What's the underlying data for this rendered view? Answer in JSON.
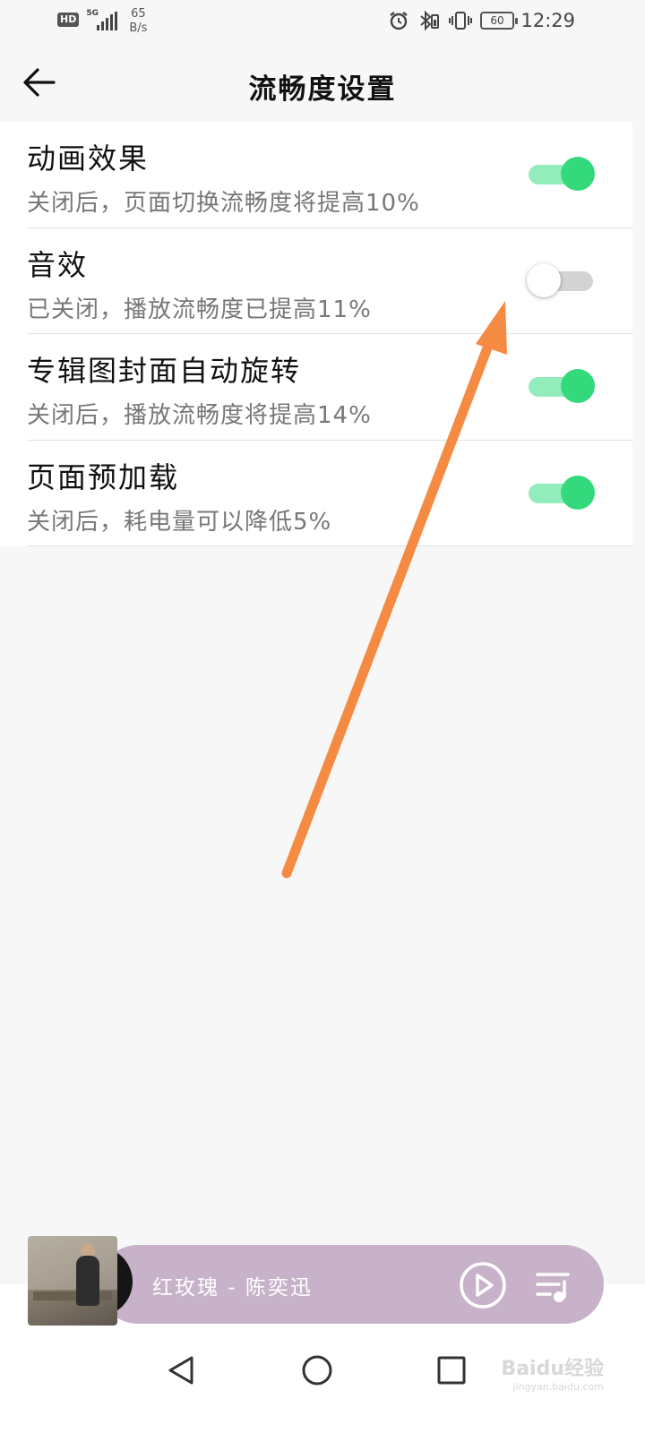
{
  "status_bar": {
    "hd": "HD",
    "network": "5G",
    "speed_value": "65",
    "speed_unit": "B/s",
    "battery": "60",
    "time": "12:29",
    "icons": [
      "alarm-icon",
      "bluetooth-icon",
      "vibrate-icon",
      "battery-icon"
    ]
  },
  "header": {
    "title": "流畅度设置",
    "back_icon": "back-arrow-icon"
  },
  "settings": [
    {
      "title": "动画效果",
      "subtitle": "关闭后，页面切换流畅度将提高10%",
      "enabled": true
    },
    {
      "title": "音效",
      "subtitle": "已关闭，播放流畅度已提高11%",
      "enabled": false
    },
    {
      "title": "专辑图封面自动旋转",
      "subtitle": "关闭后，播放流畅度将提高14%",
      "enabled": true
    },
    {
      "title": "页面预加载",
      "subtitle": "关闭后，耗电量可以降低5%",
      "enabled": true
    }
  ],
  "player": {
    "song": "红玫瑰 - 陈奕迅",
    "play_icon": "play-icon",
    "queue_icon": "playlist-icon"
  },
  "watermark": {
    "brand": "Baidu经验",
    "url": "jingyan.baidu.com"
  },
  "colors": {
    "toggle_on_track": "#92ecbb",
    "toggle_on_knob": "#33d97b",
    "player_bar": "#c7b2c9",
    "annotation_arrow": "#f58a42"
  }
}
